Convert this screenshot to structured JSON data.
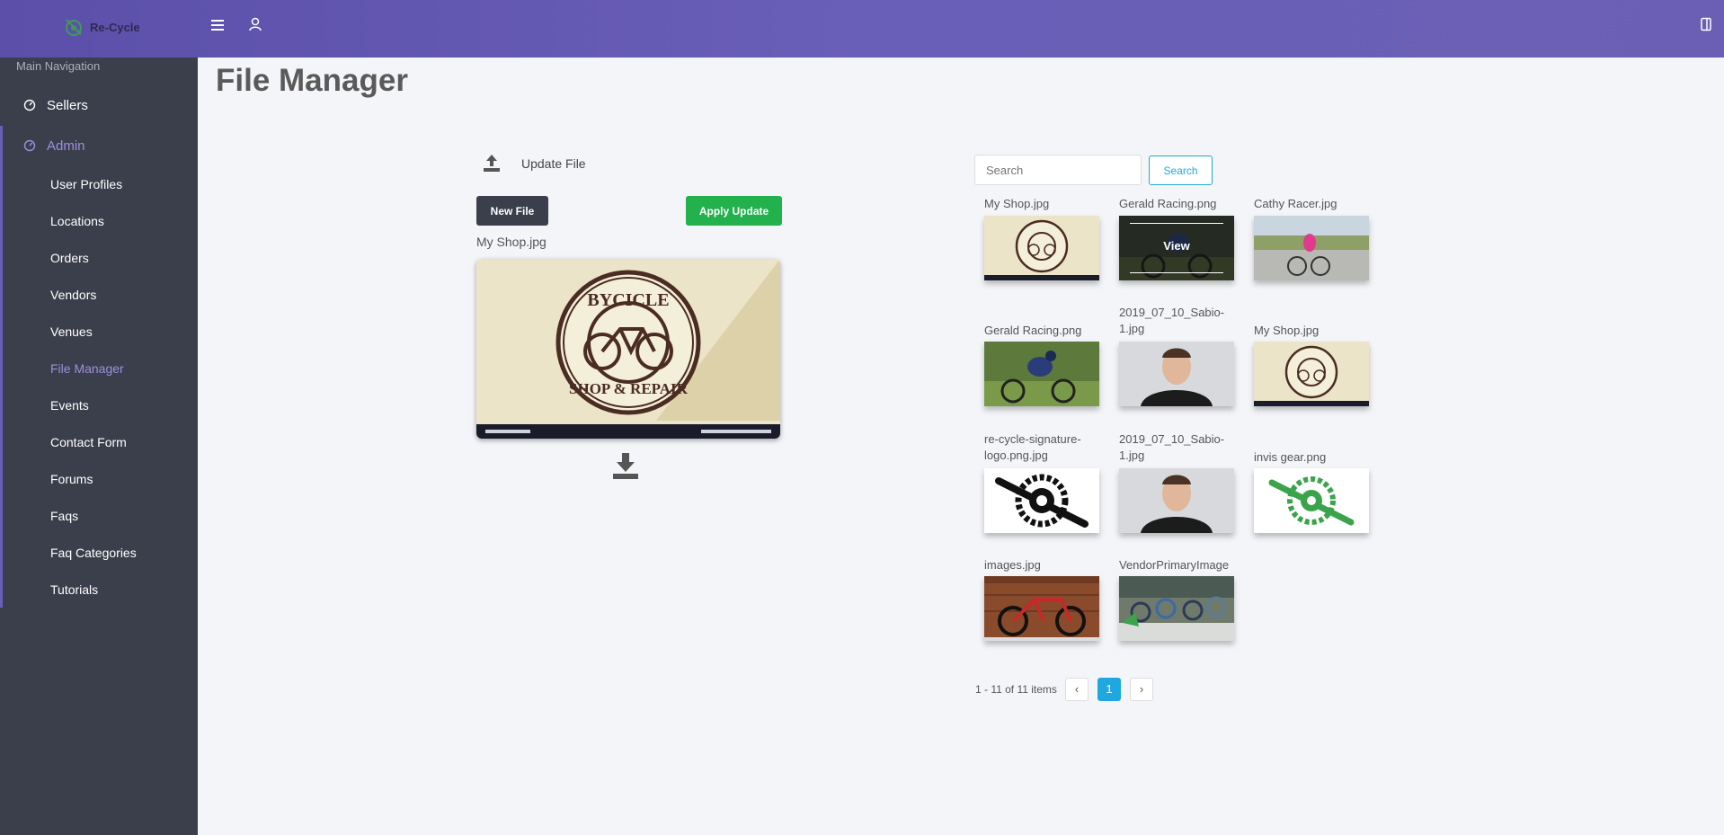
{
  "app": {
    "name": "Re-Cycle"
  },
  "sidebar": {
    "heading": "Main Navigation",
    "top_items": [
      {
        "label": "Sellers",
        "icon": "gauge-icon"
      },
      {
        "label": "Admin",
        "icon": "gauge-icon"
      }
    ],
    "admin_items": [
      {
        "label": "User Profiles"
      },
      {
        "label": "Locations"
      },
      {
        "label": "Orders"
      },
      {
        "label": "Vendors"
      },
      {
        "label": "Venues"
      },
      {
        "label": "File Manager"
      },
      {
        "label": "Events"
      },
      {
        "label": "Contact Form"
      },
      {
        "label": "Forums"
      },
      {
        "label": "Faqs"
      },
      {
        "label": "Faq Categories"
      },
      {
        "label": "Tutorials"
      }
    ],
    "active_item": "File Manager"
  },
  "page": {
    "title": "File Manager"
  },
  "editor": {
    "update_label": "Update File",
    "new_file_button": "New File",
    "apply_button": "Apply Update",
    "selected_file": "My Shop.jpg"
  },
  "search": {
    "placeholder": "Search",
    "button": "Search"
  },
  "files": [
    {
      "name": "My Shop.jpg"
    },
    {
      "name": "Gerald Racing.png",
      "hover_label": "View"
    },
    {
      "name": "Cathy Racer.jpg"
    },
    {
      "name": "Gerald Racing.png"
    },
    {
      "name": "2019_07_10_Sabio-1.jpg"
    },
    {
      "name": "My Shop.jpg"
    },
    {
      "name": "re-cycle-signature-logo.png.jpg"
    },
    {
      "name": "2019_07_10_Sabio-1.jpg"
    },
    {
      "name": "invis gear.png"
    },
    {
      "name": "images.jpg"
    },
    {
      "name": "VendorPrimaryImage"
    }
  ],
  "pagination": {
    "info": "1 - 11 of 11 items",
    "prev": "‹",
    "current": "1",
    "next": "›"
  },
  "colors": {
    "header": "#6a5fb8",
    "sidebar": "#3b3f4c",
    "accent": "#9c8fde",
    "apply": "#22b14c",
    "info": "#1fa8d8"
  }
}
